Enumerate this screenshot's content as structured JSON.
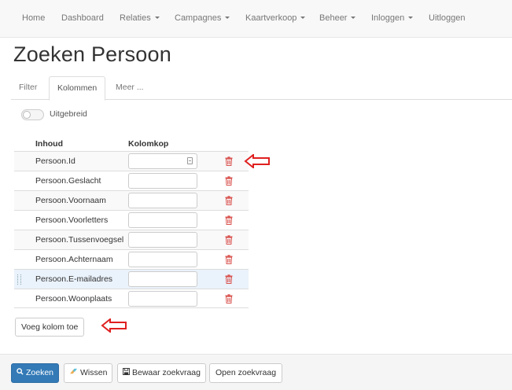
{
  "nav": {
    "items": [
      {
        "label": "Home",
        "dropdown": false
      },
      {
        "label": "Dashboard",
        "dropdown": false
      },
      {
        "label": "Relaties",
        "dropdown": true
      },
      {
        "label": "Campagnes",
        "dropdown": true
      },
      {
        "label": "Kaartverkoop",
        "dropdown": true
      },
      {
        "label": "Beheer",
        "dropdown": true
      },
      {
        "label": "Inloggen",
        "dropdown": true
      },
      {
        "label": "Uitloggen",
        "dropdown": false
      }
    ]
  },
  "page": {
    "title": "Zoeken Persoon"
  },
  "tabs": [
    {
      "label": "Filter",
      "active": false
    },
    {
      "label": "Kolommen",
      "active": true
    },
    {
      "label": "Meer ...",
      "active": false
    }
  ],
  "options": {
    "extended_label": "Uitgebreid",
    "extended_on": false
  },
  "table": {
    "headers": {
      "content": "Inhoud",
      "column_header": "Kolomkop"
    },
    "rows": [
      {
        "content": "Persoon.Id",
        "value": ""
      },
      {
        "content": "Persoon.Geslacht",
        "value": ""
      },
      {
        "content": "Persoon.Voornaam",
        "value": ""
      },
      {
        "content": "Persoon.Voorletters",
        "value": ""
      },
      {
        "content": "Persoon.Tussenvoegsel",
        "value": ""
      },
      {
        "content": "Persoon.Achternaam",
        "value": ""
      },
      {
        "content": "Persoon.E-mailadres",
        "value": ""
      },
      {
        "content": "Persoon.Woonplaats",
        "value": ""
      }
    ]
  },
  "add_column_label": "Voeg kolom toe",
  "footer": {
    "search": "Zoeken",
    "clear": "Wissen",
    "save_query": "Bewaar zoekvraag",
    "open_query": "Open zoekvraag"
  },
  "colors": {
    "primary": "#337ab7",
    "trash": "#d9534f",
    "annotation_arrow": "#e02020",
    "highlight_row": "#eaf2fb"
  }
}
